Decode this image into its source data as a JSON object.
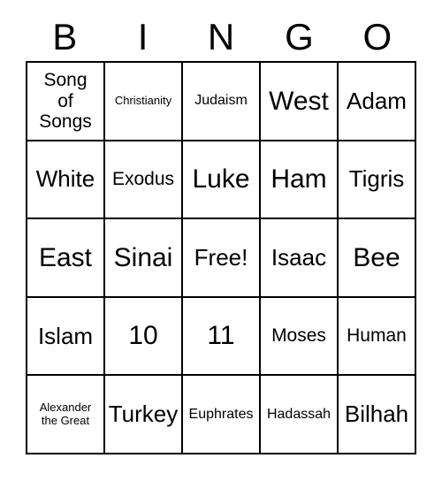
{
  "card": {
    "title": "Bingo Card",
    "header_letters": [
      "B",
      "I",
      "N",
      "G",
      "O"
    ],
    "columns": 5,
    "rows": 5,
    "border_color": "#000000",
    "background_color": "#ffffff",
    "text_color": "#000000",
    "free_space_label": "Free!",
    "free_space_position": "center",
    "cells": [
      [
        {
          "text": "Song\nof\nSongs",
          "size": "md"
        },
        {
          "text": "Christianity",
          "size": "xs"
        },
        {
          "text": "Judaism",
          "size": "sm"
        },
        {
          "text": "West",
          "size": "xl"
        },
        {
          "text": "Adam",
          "size": "lg"
        }
      ],
      [
        {
          "text": "White",
          "size": "lg"
        },
        {
          "text": "Exodus",
          "size": "md"
        },
        {
          "text": "Luke",
          "size": "xl"
        },
        {
          "text": "Ham",
          "size": "xl"
        },
        {
          "text": "Tigris",
          "size": "lg"
        }
      ],
      [
        {
          "text": "East",
          "size": "xl"
        },
        {
          "text": "Sinai",
          "size": "xl"
        },
        {
          "text": "Free!",
          "size": "lg"
        },
        {
          "text": "Isaac",
          "size": "lg"
        },
        {
          "text": "Bee",
          "size": "xl"
        }
      ],
      [
        {
          "text": "Islam",
          "size": "lg"
        },
        {
          "text": "10",
          "size": "xl"
        },
        {
          "text": "11",
          "size": "xl"
        },
        {
          "text": "Moses",
          "size": "md"
        },
        {
          "text": "Human",
          "size": "md"
        }
      ],
      [
        {
          "text": "Alexander\nthe Great",
          "size": "xs"
        },
        {
          "text": "Turkey",
          "size": "lg"
        },
        {
          "text": "Euphrates",
          "size": "sm"
        },
        {
          "text": "Hadassah",
          "size": "sm"
        },
        {
          "text": "Bilhah",
          "size": "lg"
        }
      ]
    ]
  }
}
